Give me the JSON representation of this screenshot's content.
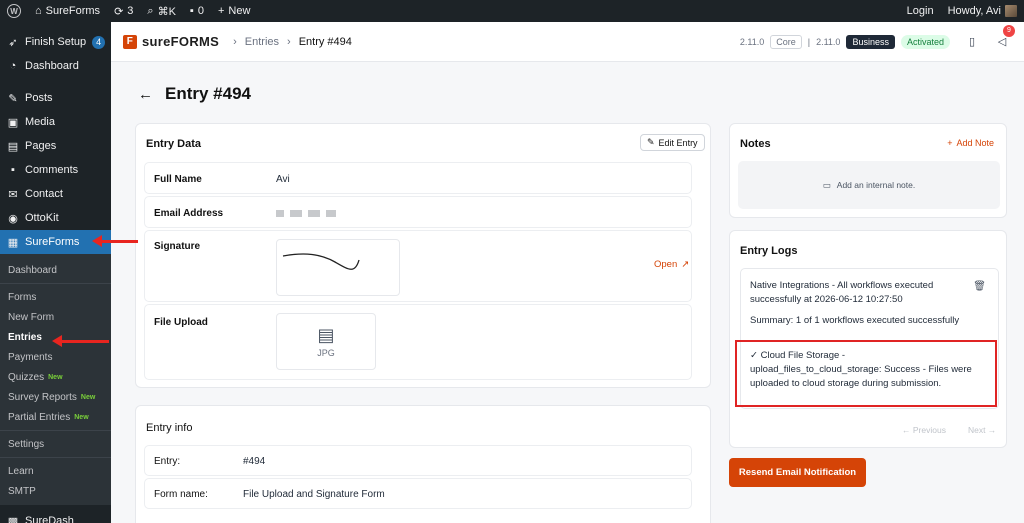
{
  "adminbar": {
    "site_name": "SureForms",
    "updates": "3",
    "search_shortcut": "⌘K",
    "comments": "0",
    "new_label": "New",
    "login_label": "Login",
    "howdy": "Howdy, Avi"
  },
  "sidebar": {
    "items": [
      {
        "label": "Finish Setup",
        "badge": "4"
      },
      {
        "label": "Dashboard"
      },
      {
        "label": "Posts"
      },
      {
        "label": "Media"
      },
      {
        "label": "Pages"
      },
      {
        "label": "Comments"
      },
      {
        "label": "Contact"
      },
      {
        "label": "OttoKit"
      },
      {
        "label": "SureForms"
      }
    ],
    "submenu": [
      "Dashboard",
      "Forms",
      "New Form",
      "Entries",
      "Payments",
      "Quizzes",
      "Survey Reports",
      "Partial Entries",
      "Settings",
      "Learn",
      "SMTP"
    ],
    "new_tag": "New",
    "bottom_item": "SureDash"
  },
  "header": {
    "logo_text": "sureFORMS",
    "crumb_entries": "Entries",
    "crumb_current": "Entry #494",
    "core_version": "2.11.0",
    "core_label": "Core",
    "business_version": "2.11.0",
    "business_label": "Business",
    "status": "Activated",
    "notifications": "9"
  },
  "page": {
    "title": "Entry #494"
  },
  "entry_data": {
    "title": "Entry Data",
    "edit_label": "Edit Entry",
    "fields": {
      "full_name_label": "Full Name",
      "full_name_value": "Avi",
      "email_label": "Email Address",
      "signature_label": "Signature",
      "open_label": "Open",
      "file_upload_label": "File Upload",
      "file_type": "JPG"
    }
  },
  "entry_info": {
    "title": "Entry info",
    "entry_label": "Entry:",
    "entry_value": "#494",
    "form_label": "Form name:",
    "form_value": "File Upload and Signature Form"
  },
  "notes": {
    "title": "Notes",
    "add_label": "Add Note",
    "placeholder": "Add an internal note."
  },
  "logs": {
    "title": "Entry Logs",
    "heading": "Native Integrations - All workflows executed successfully at 2026-06-12 10:27:50",
    "summary": "Summary: 1 of 1 workflows executed successfully",
    "detail": "✓ Cloud File Storage - upload_files_to_cloud_storage: Success - Files were uploaded to cloud storage during submission.",
    "prev_label": "Previous",
    "next_label": "Next"
  },
  "actions": {
    "resend_label": "Resend Email Notification"
  },
  "colors": {
    "accent": "#d54407",
    "wp_dark": "#1d2327",
    "wp_blue": "#2271b1",
    "annotation_red": "#e02424"
  }
}
